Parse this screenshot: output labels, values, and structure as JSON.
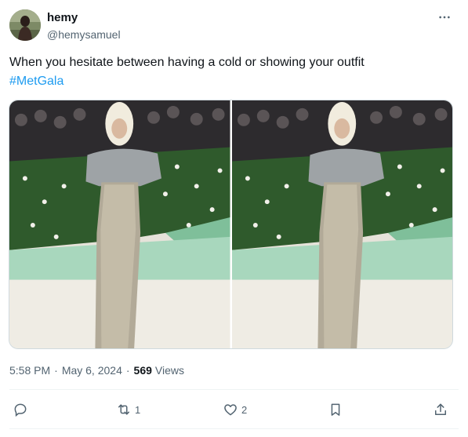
{
  "author": {
    "display_name": "hemy",
    "handle": "@hemysamuel"
  },
  "tweet": {
    "text": "When you hesitate between having a cold or showing your outfit",
    "hashtag": "#MetGala"
  },
  "media": {
    "count": 2,
    "photos": [
      {
        "subject": "woman in sequined gown with grey wrap, photographers behind"
      },
      {
        "subject": "woman in sequined gown with grey wrap, photographers behind"
      }
    ]
  },
  "meta": {
    "time": "5:58 PM",
    "date": "May 6, 2024",
    "separator": "·",
    "views_count": "569",
    "views_label": "Views"
  },
  "actions": {
    "reply_count": "",
    "retweet_count": "1",
    "like_count": "2",
    "bookmark_count": "",
    "share_count": ""
  },
  "colors": {
    "accent": "#1d9bf0",
    "text_primary": "#0f1419",
    "text_secondary": "#536471",
    "divider": "#eff3f4"
  },
  "icons": [
    "more-icon",
    "reply-icon",
    "retweet-icon",
    "like-icon",
    "bookmark-icon",
    "share-icon"
  ]
}
